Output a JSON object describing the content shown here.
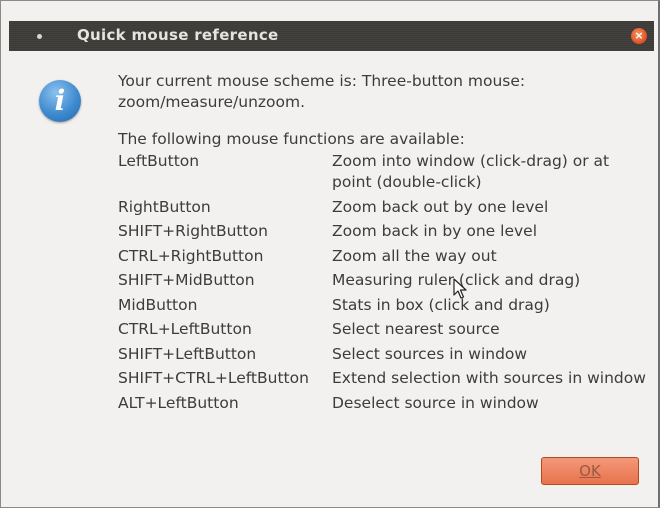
{
  "dialog": {
    "title": "Quick mouse reference",
    "close_glyph": "×",
    "icon": "info-icon",
    "icon_glyph": "i",
    "scheme_text": "Your current mouse scheme is: Three-button mouse: zoom/measure/unzoom.",
    "intro_text": "The following mouse functions are available:",
    "functions": [
      {
        "button": "LeftButton",
        "action": "Zoom into window (click-drag) or at point (double-click)"
      },
      {
        "button": "RightButton",
        "action": "Zoom back out by one level"
      },
      {
        "button": "SHIFT+RightButton",
        "action": "Zoom back in by one level"
      },
      {
        "button": "CTRL+RightButton",
        "action": "Zoom all the way out"
      },
      {
        "button": "SHIFT+MidButton",
        "action": "Measuring ruler (click and drag)"
      },
      {
        "button": "MidButton",
        "action": "Stats in box (click and drag)"
      },
      {
        "button": "CTRL+LeftButton",
        "action": "Select nearest source"
      },
      {
        "button": "SHIFT+LeftButton",
        "action": "Select sources in window"
      },
      {
        "button": "SHIFT+CTRL+LeftButton",
        "action": "Extend selection with sources in window"
      },
      {
        "button": "ALT+LeftButton",
        "action": "Deselect source in window"
      }
    ],
    "ok_label": "OK"
  },
  "colors": {
    "titlebar": "#3c3b37",
    "close_button": "#e2572a",
    "ok_button": "#e8734c",
    "background": "#f2f1ef",
    "text": "#3c3c3c",
    "info_icon": "#3f8bd0"
  }
}
